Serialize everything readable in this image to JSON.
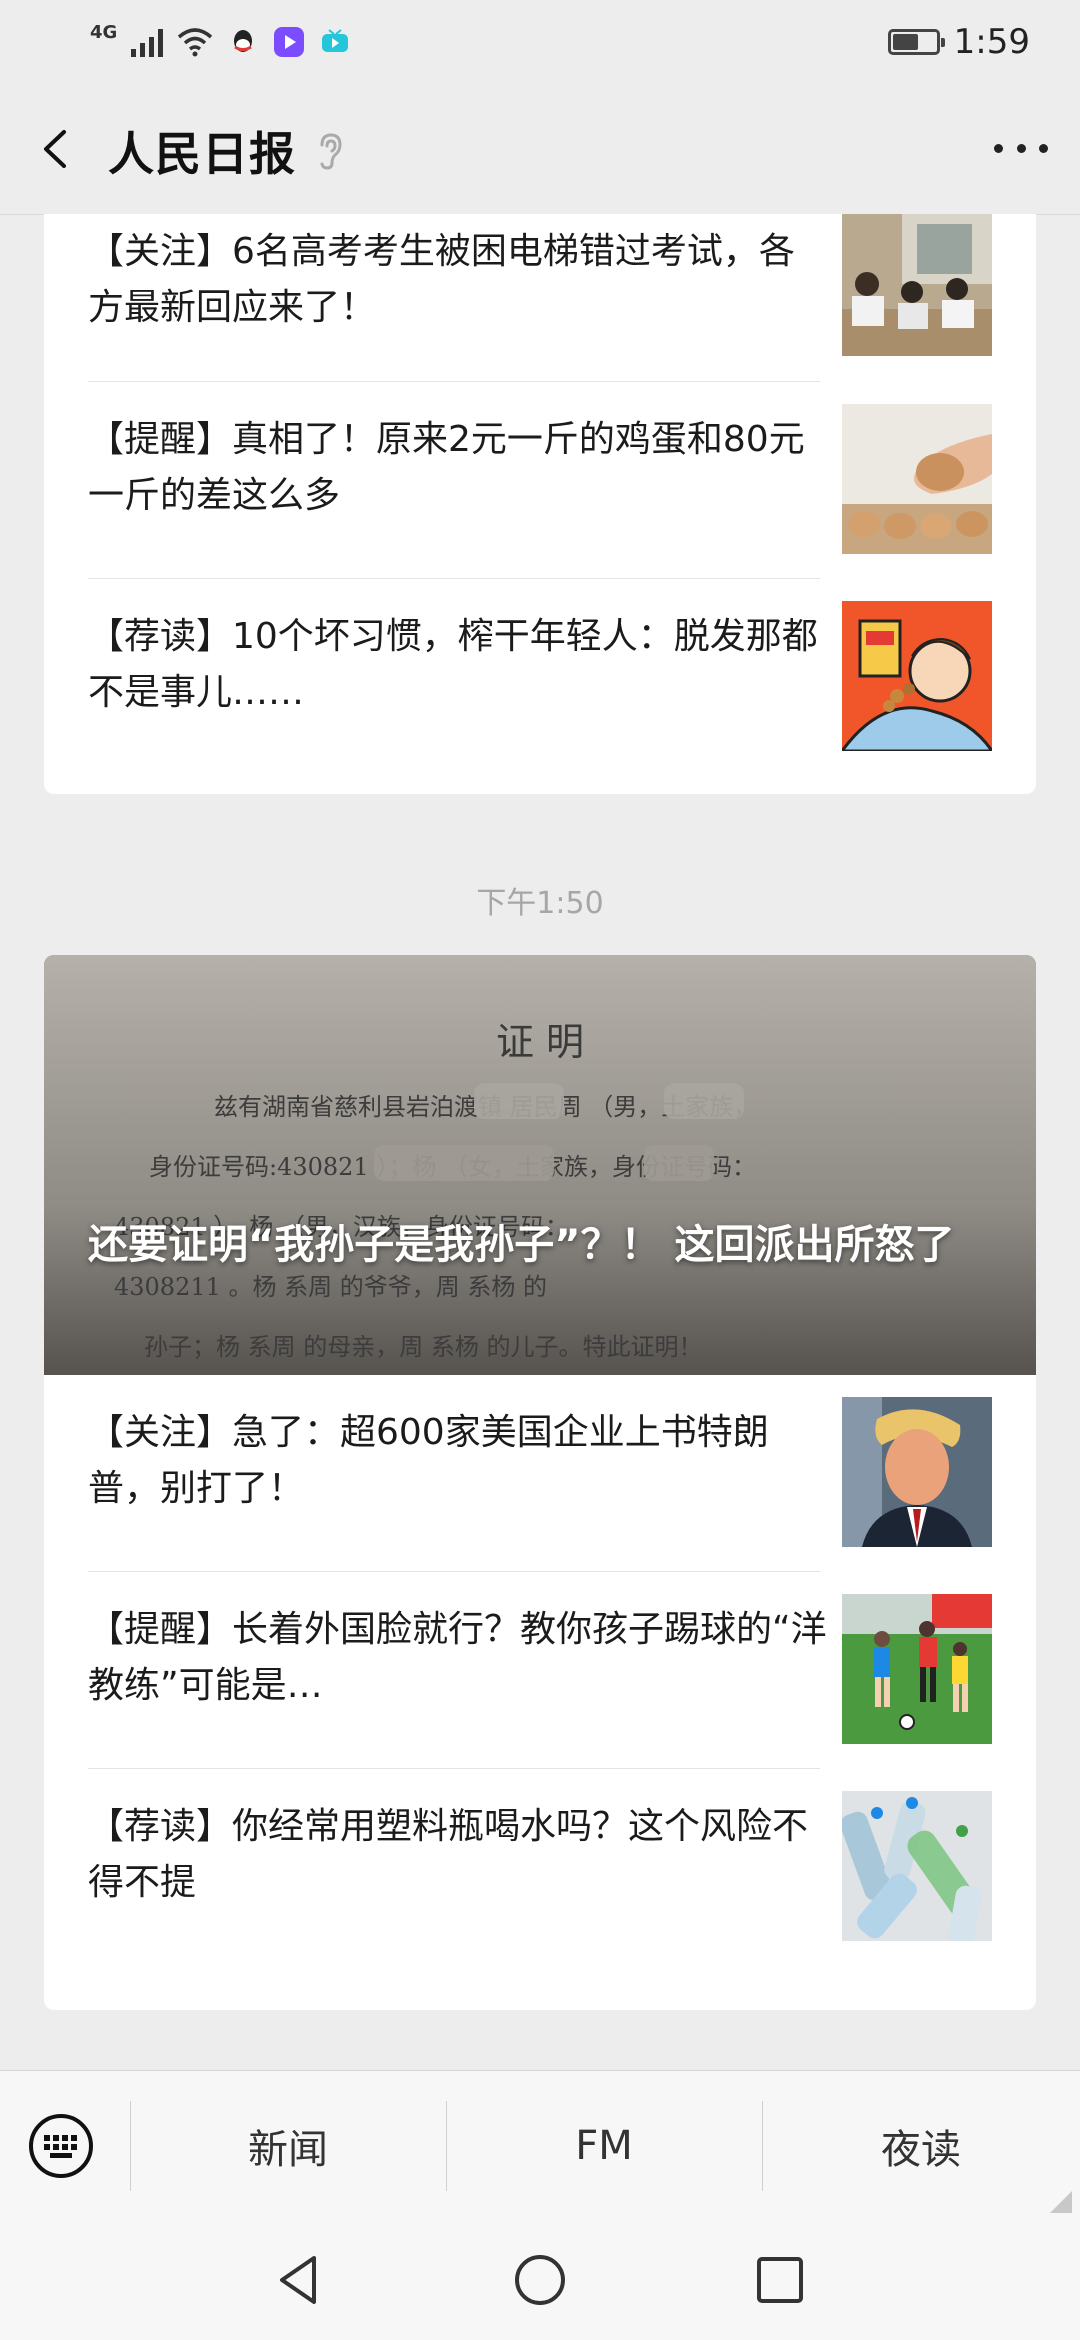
{
  "status_bar": {
    "network": "4G",
    "time": "1:59",
    "battery_percent": 60,
    "icons": [
      "signal-icon",
      "wifi-icon",
      "qq-icon",
      "video-app-icon",
      "tv-app-icon",
      "battery-icon"
    ]
  },
  "header": {
    "title": "人民日报",
    "icons": [
      "back-icon",
      "ear-icon",
      "more-icon"
    ]
  },
  "top_card": {
    "items": [
      {
        "text": "【关注】6名高考考生被困电梯错过考试，各方最新回应来了！",
        "thumb": "students-photo"
      },
      {
        "text": "【提醒】真相了！原来2元一斤的鸡蛋和80元一斤的差这么多",
        "thumb": "eggs-photo"
      },
      {
        "text": "【荐读】10个坏习惯，榨干年轻人：脱发那都不是事儿……",
        "thumb": "cartoon-illustration"
      }
    ]
  },
  "timestamp": "下午1:50",
  "bottom_card": {
    "cover": {
      "title": "还要证明“我孙子是我孙子”？！ 这回派出所怒了",
      "doc_heading": "证  明",
      "doc_lines": [
        "兹有湖南省慈利县岩泊渡镇      居民周      （男，土家族，",
        "身份证号码:430821               ）；杨     （女，土家族，身份证号码：",
        "430821              ）、杨       （男，汉族，身份证号码：",
        "4308211              。杨       系周      的爷爷，周        系杨        的",
        "孙子；杨     系周       的母亲，周       系杨       的儿子。特此证明！"
      ]
    },
    "items": [
      {
        "text": "【关注】急了：超600家美国企业上书特朗普，别打了！",
        "thumb": "portrait-photo"
      },
      {
        "text": "【提醒】长着外国脸就行？教你孩子踢球的“洋教练”可能是…",
        "thumb": "soccer-photo"
      },
      {
        "text": "【荐读】你经常用塑料瓶喝水吗？这个风险不得不提",
        "thumb": "bottles-photo"
      }
    ]
  },
  "menu": {
    "items": [
      "新闻",
      "FM",
      "夜读"
    ],
    "icons": [
      "keyboard-icon"
    ]
  },
  "system_nav": {
    "icons": [
      "nav-back-icon",
      "nav-home-icon",
      "nav-recents-icon"
    ]
  }
}
